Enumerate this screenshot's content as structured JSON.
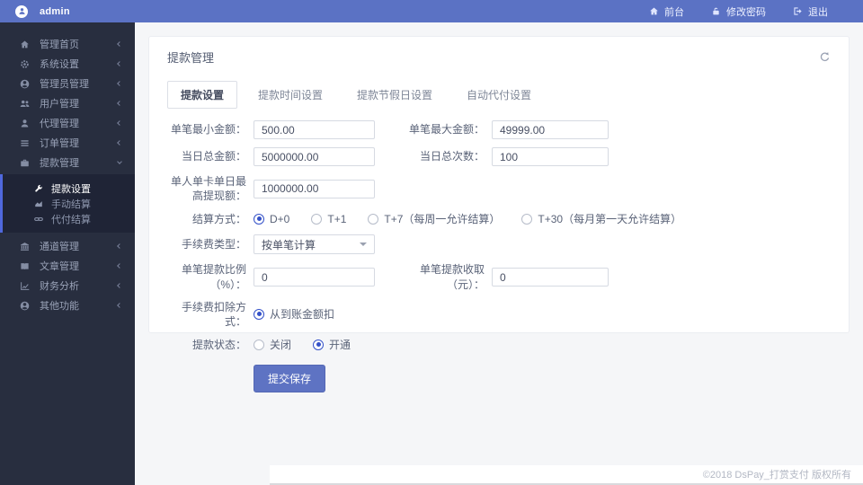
{
  "theme": {
    "topbar_color": "#5b72c4",
    "sidebar_color": "#282e3f",
    "submenu_accent": "#4f68dd",
    "primary_blue": "#3451c8",
    "button_color": "#5e73c3",
    "content_bg": "#f5f6f8"
  },
  "topbar": {
    "brand": "admin",
    "brand_icon": "user-avatar-icon",
    "nav": [
      {
        "label": "前台",
        "icon": "home-icon"
      },
      {
        "label": "修改密码",
        "icon": "unlock-icon"
      },
      {
        "label": "退出",
        "icon": "logout-icon"
      }
    ]
  },
  "sidebar": {
    "menu_top": [
      {
        "label": "管理首页",
        "icon": "home-icon"
      },
      {
        "label": "系统设置",
        "icon": "gear-icon"
      },
      {
        "label": "管理员管理",
        "icon": "user-circle-icon"
      },
      {
        "label": "用户管理",
        "icon": "users-icon"
      },
      {
        "label": "代理管理",
        "icon": "user-icon"
      },
      {
        "label": "订单管理",
        "icon": "list-icon"
      },
      {
        "label": "提款管理",
        "icon": "briefcase-icon",
        "expanded": true
      }
    ],
    "submenu": [
      {
        "label": "提款设置",
        "icon": "wrench-icon",
        "active": true
      },
      {
        "label": "手动结算",
        "icon": "area-chart-icon",
        "active": false
      },
      {
        "label": "代付结算",
        "icon": "link-icon",
        "active": false
      }
    ],
    "menu_bottom": [
      {
        "label": "通道管理",
        "icon": "bank-icon"
      },
      {
        "label": "文章管理",
        "icon": "book-icon"
      },
      {
        "label": "财务分析",
        "icon": "line-chart-icon"
      },
      {
        "label": "其他功能",
        "icon": "user-circle-icon"
      }
    ]
  },
  "page": {
    "title": "提款管理"
  },
  "tabs": [
    {
      "label": "提款设置",
      "active": true
    },
    {
      "label": "提款时间设置",
      "active": false
    },
    {
      "label": "提款节假日设置",
      "active": false
    },
    {
      "label": "自动代付设置",
      "active": false
    }
  ],
  "form": {
    "min_amount": {
      "label": "单笔最小金额：",
      "value": "500.00"
    },
    "max_amount": {
      "label": "单笔最大金额：",
      "value": "49999.00"
    },
    "daily_total": {
      "label": "当日总金额：",
      "value": "5000000.00"
    },
    "daily_count": {
      "label": "当日总次数：",
      "value": "100"
    },
    "per_card_daily_max": {
      "label": "单人单卡单日最高提现额：",
      "value": "1000000.00"
    },
    "settle_mode": {
      "label": "结算方式：",
      "options": [
        "D+0",
        "T+1",
        "T+7（每周一允许结算）",
        "T+30（每月第一天允许结算）"
      ],
      "selected": "D+0"
    },
    "fee_type": {
      "label": "手续费类型：",
      "value": "按单笔计算"
    },
    "fee_percent": {
      "label": "单笔提款比例（%）：",
      "value": "0"
    },
    "fee_fixed": {
      "label": "单笔提款收取（元）：",
      "value": "0"
    },
    "fee_deduct": {
      "label": "手续费扣除方式：",
      "options": [
        "从到账金额扣"
      ],
      "selected": "从到账金额扣"
    },
    "status": {
      "label": "提款状态：",
      "options": [
        "关闭",
        "开通"
      ],
      "selected": "开通"
    },
    "submit_label": "提交保存"
  },
  "footer": {
    "copyright": "©2018 DsPay_打赏支付 版权所有"
  }
}
